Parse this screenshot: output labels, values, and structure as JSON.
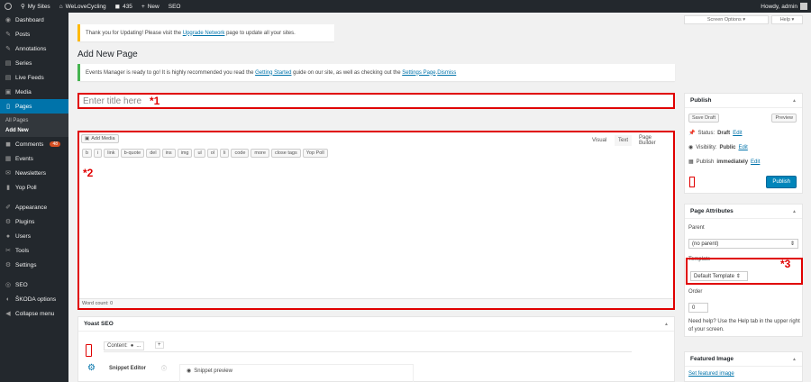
{
  "admin_bar": {
    "my_sites": "My Sites",
    "site": "WeLoveCycling",
    "comments": "435",
    "new": "New",
    "seo": "SEO",
    "howdy": "Howdy, admin"
  },
  "sidebar": {
    "items": [
      {
        "label": "Dashboard",
        "icon": "dashboard-icon",
        "glyph": "◉"
      },
      {
        "label": "Posts",
        "icon": "pin-icon",
        "glyph": "✎"
      },
      {
        "label": "Annotations",
        "icon": "annotations-icon",
        "glyph": "✎"
      },
      {
        "label": "Series",
        "icon": "series-icon",
        "glyph": "▤"
      },
      {
        "label": "Live Feeds",
        "icon": "feed-icon",
        "glyph": "▤"
      },
      {
        "label": "Media",
        "icon": "media-icon",
        "glyph": "▣"
      },
      {
        "label": "Pages",
        "icon": "pages-icon",
        "glyph": "▯"
      },
      {
        "label": "Comments",
        "icon": "comment-icon",
        "glyph": "◼",
        "badge": "48"
      },
      {
        "label": "Events",
        "icon": "events-icon",
        "glyph": "▦"
      },
      {
        "label": "Newsletters",
        "icon": "newsletter-icon",
        "glyph": "✉"
      },
      {
        "label": "Yop Poll",
        "icon": "poll-icon",
        "glyph": "▮"
      },
      {
        "label": "Appearance",
        "icon": "brush-icon",
        "glyph": "✐"
      },
      {
        "label": "Plugins",
        "icon": "plugin-icon",
        "glyph": "⚙"
      },
      {
        "label": "Users",
        "icon": "users-icon",
        "glyph": "●"
      },
      {
        "label": "Tools",
        "icon": "tools-icon",
        "glyph": "✂"
      },
      {
        "label": "Settings",
        "icon": "settings-icon",
        "glyph": "⚙"
      },
      {
        "label": "SEO",
        "icon": "seo-icon",
        "glyph": "◎"
      },
      {
        "label": "ŠKODA options",
        "icon": "options-icon",
        "glyph": "◐"
      },
      {
        "label": "Collapse menu",
        "icon": "collapse-icon",
        "glyph": "◀"
      }
    ],
    "submenu": [
      "All Pages",
      "Add New"
    ]
  },
  "screen_options": "Screen Options ▾",
  "help": "Help ▾",
  "notice_update": {
    "text": "Thank you for Updating! Please visit the ",
    "link": "Upgrade Network",
    "tail": " page to update all your sites."
  },
  "heading": "Add New Page",
  "notice_events": {
    "text": "Events Manager is ready to go! It is highly recommended you read the ",
    "link1": "Getting Started",
    "mid": " guide on our site, as well as checking out the ",
    "link2": "Settings Page",
    "sep": ". ",
    "link3": "Dismiss"
  },
  "title_placeholder": "Enter title here",
  "markers": [
    "*1",
    "*2",
    "*3"
  ],
  "editor": {
    "add_media": "Add Media",
    "tabs": [
      "Visual",
      "Text",
      "Page Builder"
    ],
    "quicktags": [
      "b",
      "i",
      "link",
      "b-quote",
      "del",
      "ins",
      "img",
      "ul",
      "ol",
      "li",
      "code",
      "more",
      "close tags",
      "Yop Poll"
    ],
    "word_count": "Word count: 0"
  },
  "publish": {
    "title": "Publish",
    "save_draft": "Save Draft",
    "preview": "Preview",
    "status_label": "Status: ",
    "status": "Draft",
    "visibility_label": "Visibility: ",
    "visibility": "Public",
    "publish_label": "Publish ",
    "publish_when": "immediately",
    "edit": "Edit",
    "publish_btn": "Publish"
  },
  "page_attributes": {
    "title": "Page Attributes",
    "parent": "Parent",
    "parent_value": "(no parent)",
    "template": "Template",
    "template_value": "Default Template",
    "order": "Order",
    "order_value": "0",
    "help": "Need help? Use the Help tab in the upper right of your screen."
  },
  "yoast": {
    "title": "Yoast SEO",
    "content": "Content:",
    "snippet_editor": "Snippet Editor",
    "snippet_preview": "Snippet preview"
  },
  "featured": {
    "title": "Featured Image",
    "link": "Set featured image"
  }
}
